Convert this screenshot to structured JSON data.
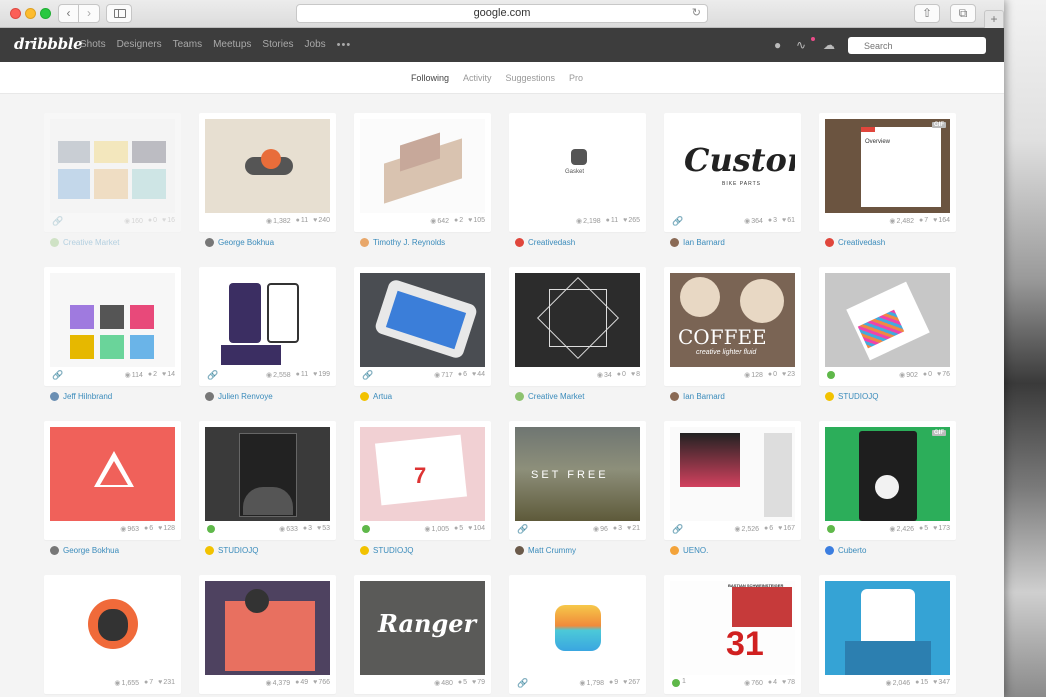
{
  "browser": {
    "url": "google.com",
    "back": "‹",
    "forward": "›",
    "reload": "↻",
    "share": "⇧",
    "tabs": "⧉",
    "newtab": "+"
  },
  "nav": {
    "logo": "dribbble",
    "links": [
      "Shots",
      "Designers",
      "Teams",
      "Meetups",
      "Stories",
      "Jobs"
    ],
    "more": "•••",
    "search_placeholder": "Search"
  },
  "subnav": {
    "items": [
      "Following",
      "Activity",
      "Suggestions",
      "Pro"
    ],
    "active": "Following"
  },
  "shots": [
    {
      "views": "160",
      "comments": "0",
      "likes": "16",
      "author": "Creative Market",
      "link": true,
      "avatar": "#8dc26f",
      "faded": true
    },
    {
      "views": "1,382",
      "comments": "11",
      "likes": "240",
      "author": "George Bokhua",
      "link": false,
      "avatar": "#777"
    },
    {
      "views": "642",
      "comments": "2",
      "likes": "105",
      "author": "Timothy J. Reynolds",
      "link": false,
      "avatar": "#e8a76a"
    },
    {
      "views": "2,198",
      "comments": "11",
      "likes": "265",
      "author": "Creativedash",
      "link": false,
      "avatar": "#e0463c",
      "label": "Gasket"
    },
    {
      "views": "364",
      "comments": "3",
      "likes": "61",
      "author": "Ian Barnard",
      "link": true,
      "avatar": "#8a6a55",
      "label": "Custom",
      "sublabel": "BIKE PARTS"
    },
    {
      "views": "2,482",
      "comments": "7",
      "likes": "164",
      "author": "Creativedash",
      "link": false,
      "avatar": "#e0463c",
      "gif": "GIF",
      "label": "Overview"
    },
    {
      "views": "114",
      "comments": "2",
      "likes": "14",
      "author": "Jeff Hilnbrand",
      "link": true,
      "avatar": "#6b8fb3"
    },
    {
      "views": "2,558",
      "comments": "11",
      "likes": "199",
      "author": "Julien Renvoye",
      "link": true,
      "avatar": "#777"
    },
    {
      "views": "717",
      "comments": "6",
      "likes": "44",
      "author": "Artua",
      "link": true,
      "avatar": "#f2c200"
    },
    {
      "views": "34",
      "comments": "0",
      "likes": "8",
      "author": "Creative Market",
      "link": false,
      "avatar": "#8dc26f"
    },
    {
      "views": "128",
      "comments": "0",
      "likes": "23",
      "author": "Ian Barnard",
      "link": false,
      "avatar": "#8a6a55",
      "label": "COFFEE",
      "sublabel": "creative lighter fluid"
    },
    {
      "views": "902",
      "comments": "0",
      "likes": "76",
      "author": "STUDIOJQ",
      "link": false,
      "avatar": "#f2c200",
      "statIcon": "#5fb84a"
    },
    {
      "views": "963",
      "comments": "6",
      "likes": "128",
      "author": "George Bokhua",
      "link": false,
      "avatar": "#777"
    },
    {
      "views": "633",
      "comments": "3",
      "likes": "53",
      "author": "STUDIOJQ",
      "link": false,
      "avatar": "#f2c200",
      "statIcon": "#5fb84a"
    },
    {
      "views": "1,005",
      "comments": "5",
      "likes": "104",
      "author": "STUDIOJQ",
      "link": false,
      "avatar": "#f2c200",
      "statIcon": "#5fb84a"
    },
    {
      "views": "96",
      "comments": "3",
      "likes": "21",
      "author": "Matt Crummy",
      "link": true,
      "avatar": "#6b5a4a",
      "label": "SET FREE"
    },
    {
      "views": "2,526",
      "comments": "6",
      "likes": "167",
      "author": "UENO.",
      "link": true,
      "avatar": "#f3a33a"
    },
    {
      "views": "2,426",
      "comments": "5",
      "likes": "173",
      "author": "Cuberto",
      "link": false,
      "avatar": "#3c7ee0",
      "gif": "GIF",
      "statIcon": "#5fb84a"
    },
    {
      "views": "1,655",
      "comments": "7",
      "likes": "231",
      "author": "",
      "link": false,
      "avatar": ""
    },
    {
      "views": "4,379",
      "comments": "49",
      "likes": "766",
      "author": "",
      "link": false,
      "avatar": ""
    },
    {
      "views": "480",
      "comments": "5",
      "likes": "79",
      "author": "",
      "link": false,
      "avatar": "",
      "label": "Ranger"
    },
    {
      "views": "1,798",
      "comments": "9",
      "likes": "267",
      "author": "",
      "link": true,
      "avatar": ""
    },
    {
      "views": "760",
      "comments": "4",
      "likes": "78",
      "author": "",
      "link": false,
      "avatar": "",
      "label": "31",
      "sublabel": "BASTIAN SCHWEINSTEIGER",
      "statIcon": "#5fb84a",
      "statNum": "1"
    },
    {
      "views": "2,046",
      "comments": "15",
      "likes": "347",
      "author": "",
      "link": false,
      "avatar": ""
    }
  ]
}
